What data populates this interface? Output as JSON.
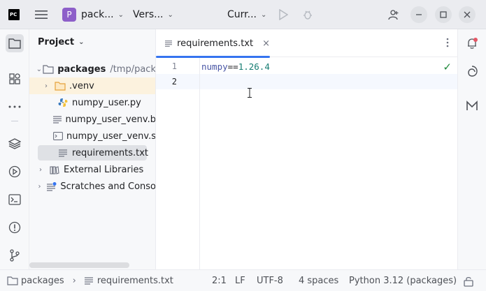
{
  "titlebar": {
    "logo_text": "PC",
    "project_badge": "P",
    "project_name": "pack...",
    "vcs_label": "Vers...",
    "run_config": "Curr...",
    "icons": [
      "hamburger-icon",
      "run-icon",
      "debug-icon",
      "add-user-icon",
      "minimize-icon",
      "maximize-icon",
      "close-icon"
    ]
  },
  "left_strip": {
    "icons": [
      "folder-icon",
      "structure-icon",
      "more-icon",
      "layers-icon",
      "services-icon",
      "terminal-icon",
      "problems-icon",
      "git-icon"
    ]
  },
  "project_panel": {
    "title": "Project",
    "tree": [
      {
        "label": "packages",
        "path": "/tmp/pack",
        "expanded": true,
        "bold": true
      },
      {
        "label": ".venv",
        "expanded": false,
        "highlighted": true
      },
      {
        "label": "numpy_user.py"
      },
      {
        "label": "numpy_user_venv.b"
      },
      {
        "label": "numpy_user_venv.s"
      },
      {
        "label": "requirements.txt",
        "selected": true
      },
      {
        "label": "External Libraries",
        "expanded": false
      },
      {
        "label": "Scratches and Conso",
        "expanded": false
      }
    ]
  },
  "editor": {
    "tab_label": "requirements.txt",
    "tab_close": "×",
    "lines": [
      {
        "num": "1",
        "pkg": "numpy",
        "op": "==",
        "ver": "1.26.4"
      },
      {
        "num": "2",
        "pkg": "",
        "op": "",
        "ver": ""
      }
    ],
    "check_glyph": "✓"
  },
  "right_strip": {
    "icons": [
      "notifications-icon",
      "ai-assistant-icon",
      "markdown-icon"
    ]
  },
  "statusbar": {
    "breadcrumb_root": "packages",
    "breadcrumb_sep": "›",
    "breadcrumb_file": "requirements.txt",
    "position": "2:1",
    "line_sep": "LF",
    "encoding": "UTF-8",
    "indent": "4 spaces",
    "interpreter": "Python 3.12 (packages)"
  }
}
